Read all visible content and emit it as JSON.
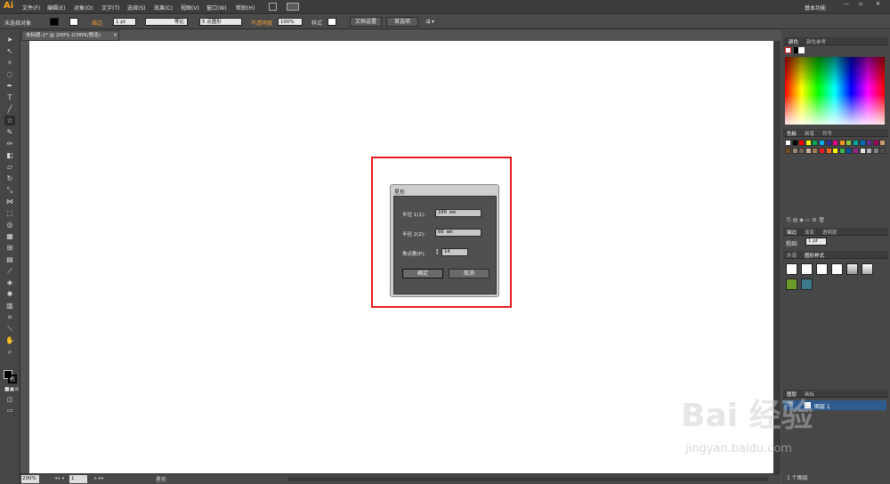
{
  "app": {
    "logo": "Ai",
    "workspace": "基本功能"
  },
  "menus": [
    "文件(F)",
    "编辑(E)",
    "对象(O)",
    "文字(T)",
    "选择(S)",
    "效果(C)",
    "视图(V)",
    "窗口(W)",
    "帮助(H)"
  ],
  "control_bar": {
    "selection": "未选择对象",
    "stroke_label": "描边",
    "stroke_weight": "1 pt",
    "profile": "等比",
    "brush": "5 点圆形",
    "opacity_label": "不透明度",
    "opacity_value": "100%",
    "style_label": "样式",
    "doc_setup": "文档设置",
    "prefs": "首选项"
  },
  "document_tab": "未标题-1* @ 200% (CMYK/预览)",
  "dialog": {
    "title": "星形",
    "radius1_label": "半径 1(1):",
    "radius1_value": "100 mm",
    "radius2_label": "半径 2(2):",
    "radius2_value": "60 mm",
    "points_label": "角点数(P):",
    "points_value": "14",
    "ok": "确定",
    "cancel": "取消"
  },
  "status_bar": {
    "zoom": "200%",
    "page": "1",
    "tool": "星形"
  },
  "panels": {
    "color_tabs": [
      "颜色",
      "颜色参考"
    ],
    "swatch_tabs": [
      "色板",
      "画笔",
      "符号"
    ],
    "stroke_tabs": [
      "描边",
      "渐变",
      "透明度"
    ],
    "stroke_weight_label": "粗细:",
    "stroke_weight_value": "1 pt",
    "appearance_tabs": [
      "外观",
      "图形样式"
    ],
    "layers_tabs": [
      "图层",
      "画板"
    ],
    "layer_name": "图层 1",
    "layers_count": "1 个图层"
  },
  "swatch_colors": [
    "#ffffff",
    "#000000",
    "#ff0000",
    "#ffff00",
    "#00a651",
    "#00aeef",
    "#2e3192",
    "#ec008c",
    "#f7941d",
    "#8dc63f",
    "#00a99d",
    "#0072bc",
    "#662d91",
    "#9e005d",
    "#c69c6d",
    "#754c24",
    "#998675",
    "#736357",
    "#c7b299",
    "#a67c52",
    "#ed1c24",
    "#f26522",
    "#fff200",
    "#39b54a",
    "#0054a6",
    "#92278f",
    "#e6e6e6",
    "#b3b3b3",
    "#808080",
    "#4d4d4d"
  ],
  "watermark": {
    "brand": "Bai 经验",
    "url": "jingyan.baidu.com"
  }
}
